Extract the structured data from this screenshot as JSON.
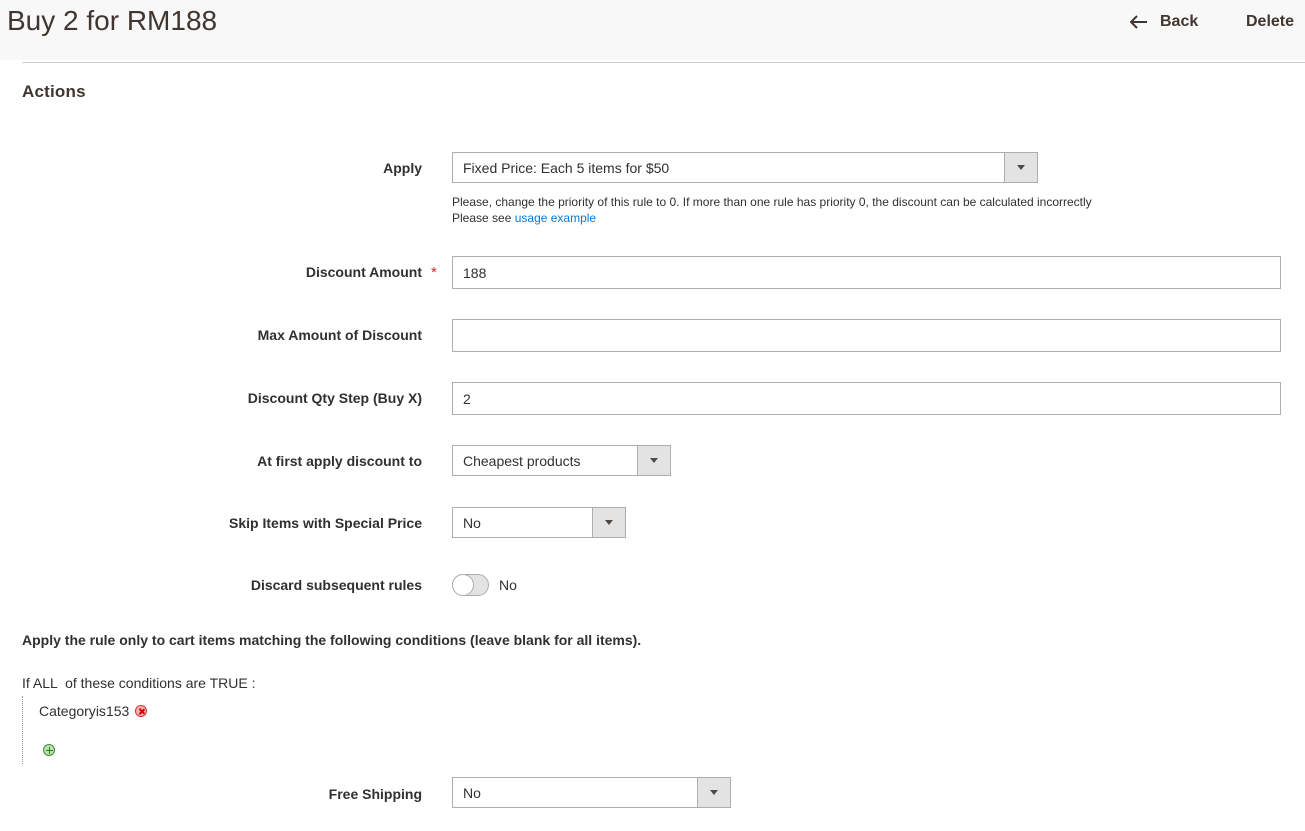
{
  "header": {
    "title": "Buy 2 for RM188",
    "back_label": "Back",
    "delete_label": "Delete"
  },
  "section": {
    "title": "Actions"
  },
  "fields": {
    "apply": {
      "label": "Apply",
      "value": "Fixed Price: Each 5 items for $50",
      "note_line1": "Please, change the priority of this rule to 0. If more than one rule has priority 0, the discount can be calculated incorrectly",
      "note_line2_prefix": "Please see ",
      "note_link": "usage example"
    },
    "discount_amount": {
      "label": "Discount Amount",
      "required_mark": "*",
      "value": "188"
    },
    "max_amount": {
      "label": "Max Amount of Discount",
      "value": ""
    },
    "qty_step": {
      "label": "Discount Qty Step (Buy X)",
      "value": "2"
    },
    "first_apply": {
      "label": "At first apply discount to",
      "value": "Cheapest products"
    },
    "skip_special": {
      "label": "Skip Items with Special Price",
      "value": "No"
    },
    "discard_rules": {
      "label": "Discard subsequent rules",
      "value": "No"
    },
    "free_shipping": {
      "label": "Free Shipping",
      "value": "No"
    }
  },
  "conditions": {
    "heading": "Apply the rule only to cart items matching the following conditions (leave blank for all items).",
    "if_text": "If",
    "aggregator": "ALL",
    "middle_text": "of these conditions are",
    "value": "TRUE",
    "suffix": ":",
    "items": [
      {
        "attribute": "Category",
        "operator": "is",
        "value": "153"
      }
    ]
  },
  "colors": {
    "header_bg": "#f8f8f8",
    "link": "#007bdb",
    "required": "#e22626"
  }
}
